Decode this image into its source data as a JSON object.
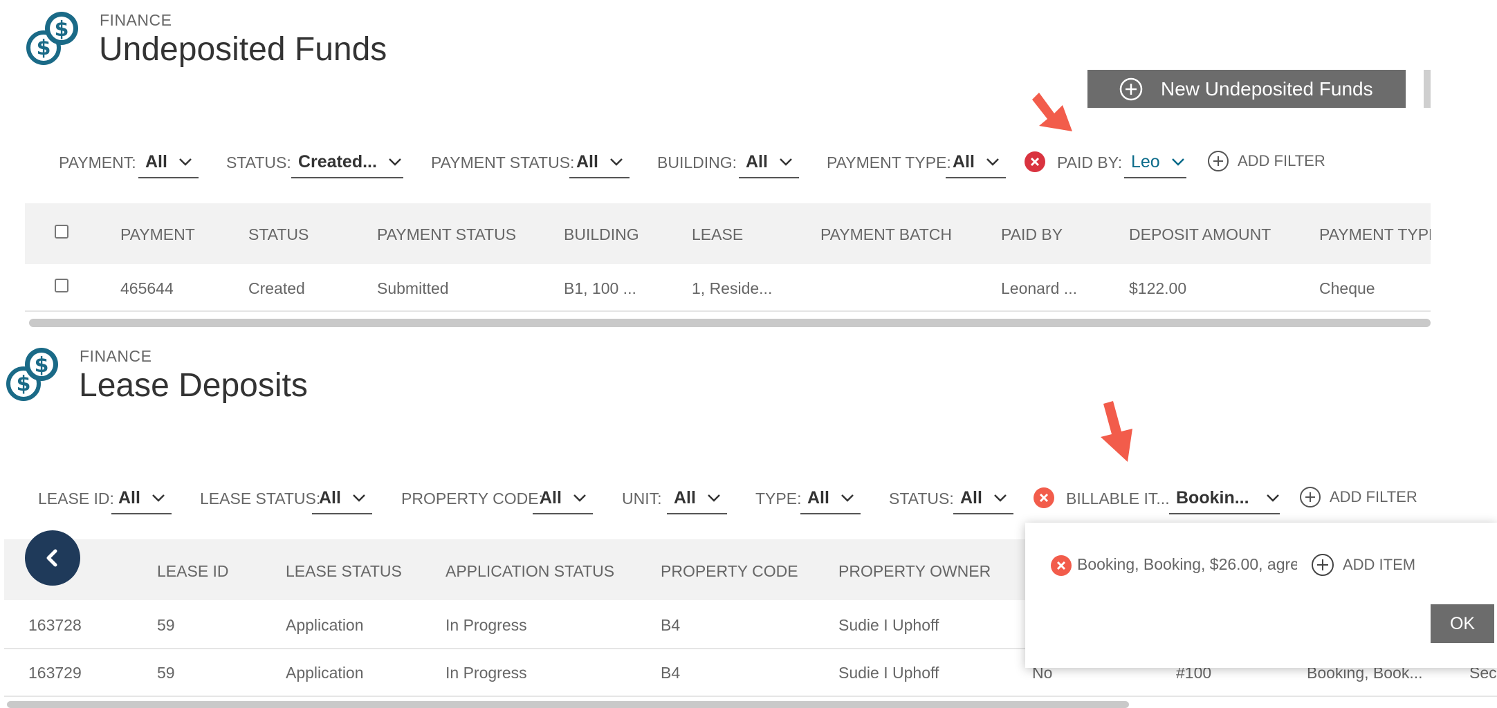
{
  "undeposited": {
    "module": "FINANCE",
    "title": "Undeposited Funds",
    "new_button_label": "New Undeposited Funds",
    "filters": [
      {
        "label": "PAYMENT:",
        "value": "All"
      },
      {
        "label": "STATUS:",
        "value": "Created..."
      },
      {
        "label": "PAYMENT STATUS:",
        "value": "All"
      },
      {
        "label": "BUILDING:",
        "value": "All"
      },
      {
        "label": "PAYMENT TYPE:",
        "value": "All"
      },
      {
        "label": "PAID BY:",
        "value": "Leo"
      }
    ],
    "add_filter_label": "ADD FILTER",
    "columns": [
      "PAYMENT",
      "STATUS",
      "PAYMENT STATUS",
      "BUILDING",
      "LEASE",
      "PAYMENT BATCH",
      "PAID BY",
      "DEPOSIT AMOUNT",
      "PAYMENT TYPE"
    ],
    "rows": [
      {
        "payment": "465644",
        "status": "Created",
        "payment_status": "Submitted",
        "building": "B1, 100 ...",
        "lease": "1, Reside...",
        "payment_batch": "",
        "paid_by": "Leonard ...",
        "deposit_amount": "$122.00",
        "payment_type": "Cheque"
      }
    ]
  },
  "lease_deposits": {
    "module": "FINANCE",
    "title": "Lease Deposits",
    "filters": [
      {
        "label": "LEASE ID:",
        "value": "All"
      },
      {
        "label": "LEASE STATUS:",
        "value": "All"
      },
      {
        "label": "PROPERTY CODE:",
        "value": "All"
      },
      {
        "label": "UNIT:",
        "value": "All"
      },
      {
        "label": "TYPE:",
        "value": "All"
      },
      {
        "label": "STATUS:",
        "value": "All"
      },
      {
        "label": "BILLABLE IT...",
        "value": "Bookin..."
      }
    ],
    "add_filter_label": "ADD FILTER",
    "columns": [
      "LEASE ID",
      "LEASE STATUS",
      "APPLICATION STATUS",
      "PROPERTY CODE",
      "PROPERTY OWNER"
    ],
    "rows": [
      {
        "id": "163728",
        "lease_id": "59",
        "lease_status": "Application",
        "application_status": "In Progress",
        "property_code": "B4",
        "property_owner": "Sudie I Uphoff",
        "col7": "",
        "col8": "",
        "col9": "",
        "col10": ""
      },
      {
        "id": "163729",
        "lease_id": "59",
        "lease_status": "Application",
        "application_status": "In Progress",
        "property_code": "B4",
        "property_owner": "Sudie I Uphoff",
        "col7": "No",
        "col8": "#100",
        "col9": "Booking, Book...",
        "col10": "Sec"
      }
    ],
    "popup": {
      "item_text": "Booking, Booking, $26.00, agre",
      "add_item_label": "ADD ITEM",
      "ok_label": "OK"
    }
  },
  "colors": {
    "accent": "#0b6b8a",
    "arrow": "#f25c4b",
    "remove": "#d9333f",
    "button": "#6c6c6c"
  },
  "icons": {
    "logo": "finance-dollar-coins-icon",
    "back": "chevron-left-icon",
    "remove": "close-circle-icon",
    "add": "plus-circle-icon",
    "annotation": "red-arrow-icon"
  }
}
